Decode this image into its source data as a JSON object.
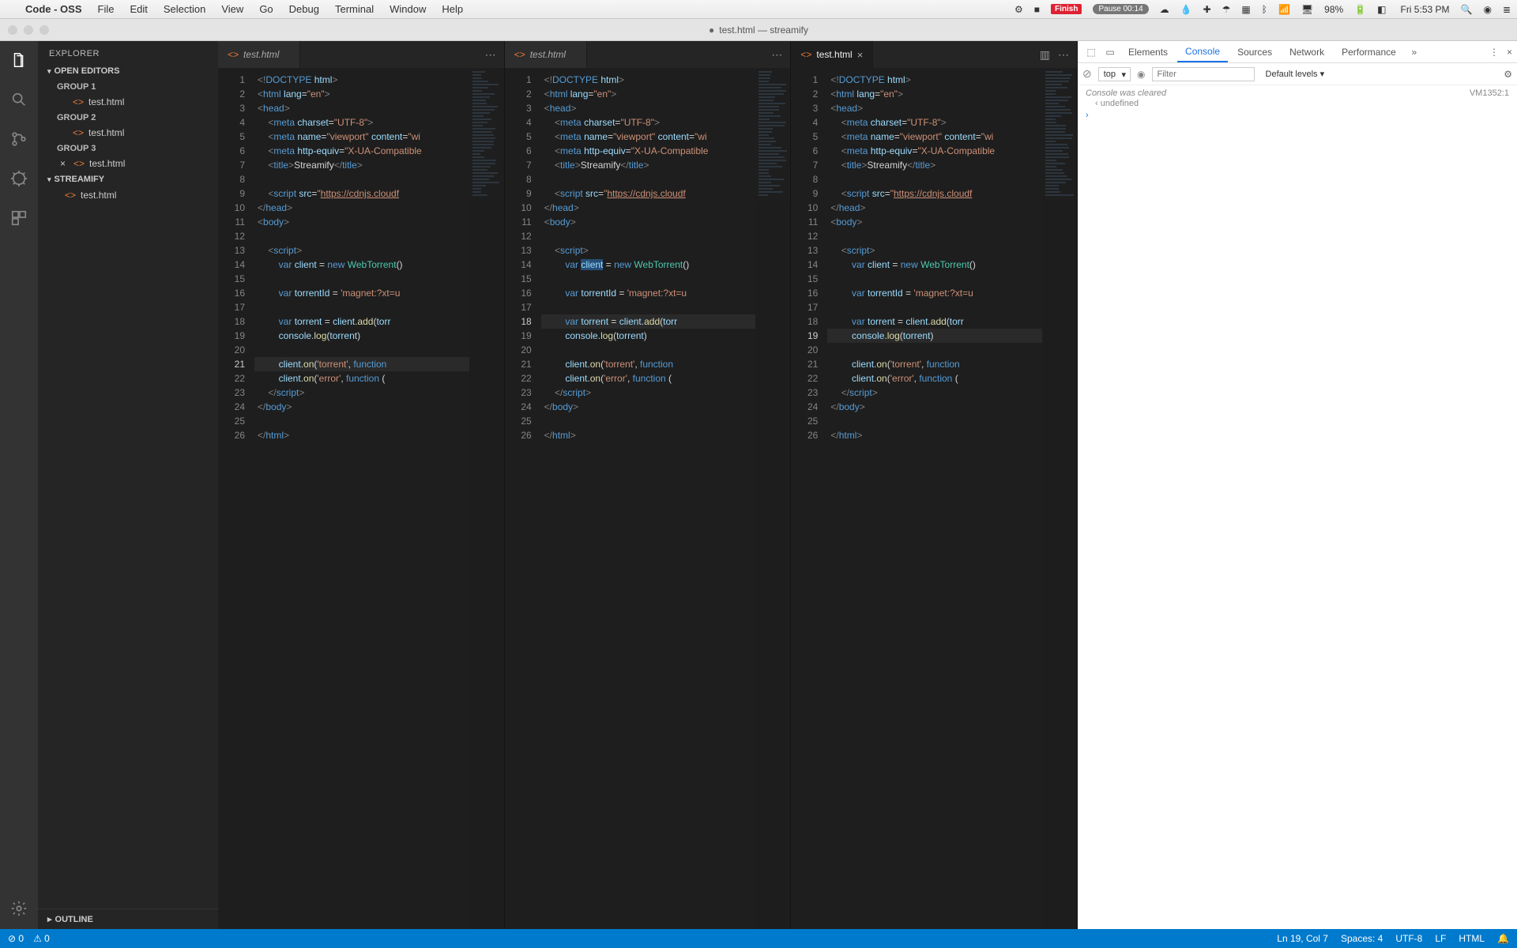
{
  "mac": {
    "app_name": "Code - OSS",
    "menu": [
      "File",
      "Edit",
      "Selection",
      "View",
      "Go",
      "Debug",
      "Terminal",
      "Window",
      "Help"
    ],
    "finish": "Finish",
    "pause": "Pause 00:14",
    "battery_pct": "98%",
    "clock": "Fri 5:53 PM"
  },
  "window": {
    "title_dot": "●",
    "title": "test.html — streamify"
  },
  "sidebar": {
    "title": "EXPLORER",
    "open_editors": "OPEN EDITORS",
    "groups": [
      {
        "label": "GROUP 1",
        "file": "test.html"
      },
      {
        "label": "GROUP 2",
        "file": "test.html"
      },
      {
        "label": "GROUP 3",
        "file": "test.html",
        "close": true
      }
    ],
    "project": "STREAMIFY",
    "project_file": "test.html",
    "outline": "OUTLINE"
  },
  "tab": {
    "name": "test.html"
  },
  "panes": [
    {
      "active_tab": false,
      "current_line": 21
    },
    {
      "active_tab": false,
      "current_line": 18
    },
    {
      "active_tab": true,
      "current_line": 19
    }
  ],
  "code_lines": [
    {
      "n": 1,
      "html": "<span class='t-bracket'>&lt;!</span><span class='t-tag'>DOCTYPE</span> <span class='t-attr'>html</span><span class='t-bracket'>&gt;</span>"
    },
    {
      "n": 2,
      "html": "<span class='t-bracket'>&lt;</span><span class='t-tag'>html</span> <span class='t-attr'>lang</span>=<span class='t-str'>\"en\"</span><span class='t-bracket'>&gt;</span>"
    },
    {
      "n": 3,
      "html": "<span class='t-bracket'>&lt;</span><span class='t-tag'>head</span><span class='t-bracket'>&gt;</span>"
    },
    {
      "n": 4,
      "html": "    <span class='t-bracket'>&lt;</span><span class='t-tag'>meta</span> <span class='t-attr'>charset</span>=<span class='t-str'>\"UTF-8\"</span><span class='t-bracket'>&gt;</span>"
    },
    {
      "n": 5,
      "html": "    <span class='t-bracket'>&lt;</span><span class='t-tag'>meta</span> <span class='t-attr'>name</span>=<span class='t-str'>\"viewport\"</span> <span class='t-attr'>content</span>=<span class='t-str'>\"wi</span>"
    },
    {
      "n": 6,
      "html": "    <span class='t-bracket'>&lt;</span><span class='t-tag'>meta</span> <span class='t-attr'>http-equiv</span>=<span class='t-str'>\"X-UA-Compatible</span>"
    },
    {
      "n": 7,
      "html": "    <span class='t-bracket'>&lt;</span><span class='t-tag'>title</span><span class='t-bracket'>&gt;</span><span class='t-text'>Streamify</span><span class='t-bracket'>&lt;/</span><span class='t-tag'>title</span><span class='t-bracket'>&gt;</span>"
    },
    {
      "n": 8,
      "html": ""
    },
    {
      "n": 9,
      "html": "    <span class='t-bracket'>&lt;</span><span class='t-tag'>script</span> <span class='t-attr'>src</span>=<span class='t-str'>\"</span><span class='t-link'>https://cdnjs.cloudf</span>"
    },
    {
      "n": 10,
      "html": "<span class='t-bracket'>&lt;/</span><span class='t-tag'>head</span><span class='t-bracket'>&gt;</span>"
    },
    {
      "n": 11,
      "html": "<span class='t-bracket'>&lt;</span><span class='t-tag'>body</span><span class='t-bracket'>&gt;</span>"
    },
    {
      "n": 12,
      "html": ""
    },
    {
      "n": 13,
      "html": "    <span class='t-bracket'>&lt;</span><span class='t-tag'>script</span><span class='t-bracket'>&gt;</span>"
    },
    {
      "n": 14,
      "html": "        <span class='t-kw'>var</span> <span class='t-obj'>client</span> = <span class='t-new'>new</span> <span class='t-fn'>WebTorrent</span>()"
    },
    {
      "n": 15,
      "html": ""
    },
    {
      "n": 16,
      "html": "        <span class='t-kw'>var</span> <span class='t-obj'>torrentId</span> = <span class='t-str'>'magnet:?xt=u</span>"
    },
    {
      "n": 17,
      "html": ""
    },
    {
      "n": 18,
      "html": "        <span class='t-kw'>var</span> <span class='t-obj'>torrent</span> = <span class='t-obj'>client</span>.<span class='t-func2'>add</span>(<span class='t-obj'>torr</span>"
    },
    {
      "n": 19,
      "html": "        <span class='t-obj'>console</span>.<span class='t-func2'>log</span>(<span class='t-obj'>torrent</span>)"
    },
    {
      "n": 20,
      "html": ""
    },
    {
      "n": 21,
      "html": "        <span class='t-obj'>client</span>.<span class='t-func2'>on</span>(<span class='t-str'>'torrent'</span>, <span class='t-kw'>function</span>"
    },
    {
      "n": 22,
      "html": "        <span class='t-obj'>client</span>.<span class='t-func2'>on</span>(<span class='t-str'>'error'</span>, <span class='t-kw'>function</span> ("
    },
    {
      "n": 23,
      "html": "    <span class='t-bracket'>&lt;/</span><span class='t-tag'>script</span><span class='t-bracket'>&gt;</span>"
    },
    {
      "n": 24,
      "html": "<span class='t-bracket'>&lt;/</span><span class='t-tag'>body</span><span class='t-bracket'>&gt;</span>"
    },
    {
      "n": 25,
      "html": ""
    },
    {
      "n": 26,
      "html": "<span class='t-bracket'>&lt;/</span><span class='t-tag'>html</span><span class='t-bracket'>&gt;</span>"
    }
  ],
  "devtools": {
    "tabs": [
      "Elements",
      "Console",
      "Sources",
      "Network",
      "Performance"
    ],
    "active_tab": "Console",
    "context": "top",
    "filter_placeholder": "Filter",
    "levels": "Default levels ▾",
    "msg": "Console was cleared",
    "msg_src": "VM1352:1",
    "result": "undefined"
  },
  "statusbar": {
    "errors": "⊘ 0",
    "warnings": "⚠ 0",
    "position": "Ln 19, Col 7",
    "spaces": "Spaces: 4",
    "encoding": "UTF-8",
    "eol": "LF",
    "lang": "HTML",
    "bell": "🔔"
  }
}
